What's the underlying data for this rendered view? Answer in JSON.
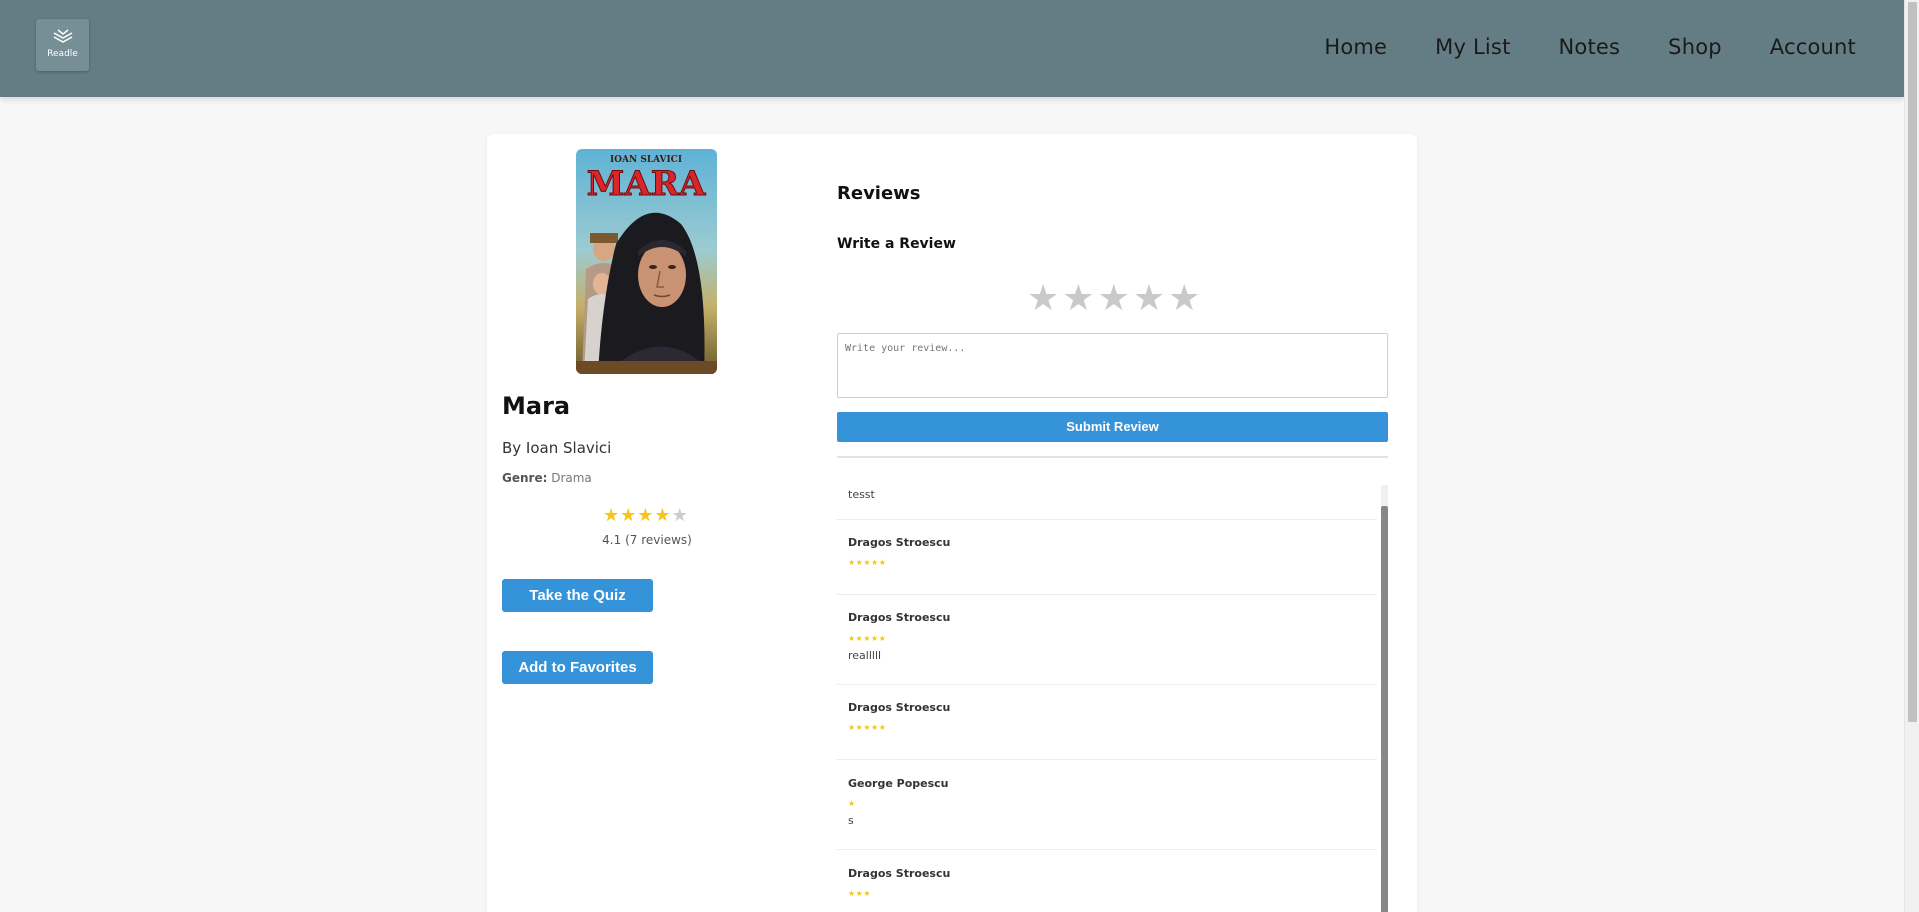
{
  "header": {
    "logo_text": "Readle",
    "nav": [
      "Home",
      "My List",
      "Notes",
      "Shop",
      "Account"
    ]
  },
  "book": {
    "cover_author": "IOAN SLAVICI",
    "cover_title": "MARA",
    "title": "Mara",
    "author": "By Ioan Slavici",
    "genre_label": "Genre:",
    "genre": "Drama",
    "rating_value": 4.1,
    "rating_text": "4.1 (7 reviews)"
  },
  "actions": {
    "quiz": "Take the Quiz",
    "favorites": "Add to Favorites"
  },
  "reviews_section": {
    "heading": "Reviews",
    "write_heading": "Write a Review",
    "placeholder": "Write your review...",
    "submit": "Submit Review"
  },
  "reviews": [
    {
      "name": "",
      "stars": 0,
      "text": "tesst"
    },
    {
      "name": "Dragos Stroescu",
      "stars": 5,
      "text": ""
    },
    {
      "name": "Dragos Stroescu",
      "stars": 5,
      "text": "realllll"
    },
    {
      "name": "Dragos Stroescu",
      "stars": 5,
      "text": ""
    },
    {
      "name": "George Popescu",
      "stars": 1,
      "text": "s"
    },
    {
      "name": "Dragos Stroescu",
      "stars": 3,
      "text": ""
    }
  ],
  "colors": {
    "header_bg": "#647d85",
    "accent_blue": "#3593d9",
    "star_gold": "#f5c518"
  }
}
